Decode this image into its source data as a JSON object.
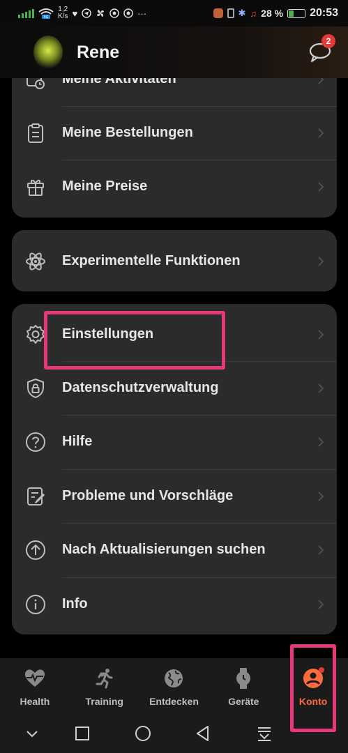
{
  "status_bar": {
    "network_speed": "1,2\nK/s",
    "speed_value": "1,2",
    "speed_unit": "K/s",
    "wifi_label": "5G",
    "battery_percent": "28 %",
    "battery_level": 0.28,
    "time": "20:53"
  },
  "header": {
    "user_name": "Rene",
    "message_badge": "2"
  },
  "menu": {
    "group1": [
      {
        "label": "Meine Aktivitäten",
        "icon": "activity-clock-icon"
      },
      {
        "label": "Meine Bestellungen",
        "icon": "clipboard-icon"
      },
      {
        "label": "Meine Preise",
        "icon": "gift-icon"
      }
    ],
    "group2": [
      {
        "label": "Experimentelle Funktionen",
        "icon": "atom-icon"
      }
    ],
    "group3": [
      {
        "label": "Einstellungen",
        "icon": "gear-icon"
      },
      {
        "label": "Datenschutzverwaltung",
        "icon": "shield-lock-icon"
      },
      {
        "label": "Hilfe",
        "icon": "help-circle-icon"
      },
      {
        "label": "Probleme und Vorschläge",
        "icon": "edit-note-icon"
      },
      {
        "label": "Nach Aktualisierungen suchen",
        "icon": "arrow-up-circle-icon"
      },
      {
        "label": "Info",
        "icon": "info-circle-icon"
      }
    ]
  },
  "bottom_nav": [
    {
      "label": "Health",
      "icon": "heart-pulse-icon",
      "active": false
    },
    {
      "label": "Training",
      "icon": "runner-icon",
      "active": false
    },
    {
      "label": "Entdecken",
      "icon": "globe-icon",
      "active": false
    },
    {
      "label": "Geräte",
      "icon": "watch-icon",
      "active": false
    },
    {
      "label": "Konto",
      "icon": "account-icon",
      "active": true
    }
  ],
  "colors": {
    "accent": "#ff6b3d",
    "highlight": "#e8377a",
    "card": "#2b2b2b",
    "badge": "#e53935"
  }
}
